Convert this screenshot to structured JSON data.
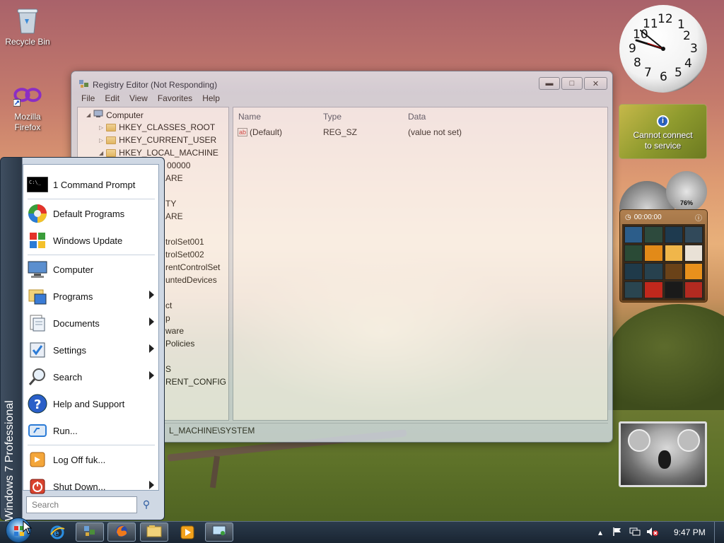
{
  "desktop": {
    "icons": [
      {
        "label": "Recycle Bin",
        "icon": "recycle-bin-icon"
      },
      {
        "label": "Mozilla Firefox",
        "icon": "firefox-shortcut-icon"
      }
    ]
  },
  "registry_window": {
    "title": "Registry Editor (Not Responding)",
    "menu": [
      "File",
      "Edit",
      "View",
      "Favorites",
      "Help"
    ],
    "tree": [
      {
        "label": "Computer"
      },
      {
        "label": "HKEY_CLASSES_ROOT"
      },
      {
        "label": "HKEY_CURRENT_USER"
      },
      {
        "label": "HKEY_LOCAL_MACHINE"
      },
      {
        "label": "00000"
      },
      {
        "label": "ARE"
      },
      {
        "label": "TY"
      },
      {
        "label": "ARE"
      },
      {
        "label": "trolSet001"
      },
      {
        "label": "trolSet002"
      },
      {
        "label": "rentControlSet"
      },
      {
        "label": "untedDevices"
      },
      {
        "label": "ct"
      },
      {
        "label": "p"
      },
      {
        "label": "ware"
      },
      {
        "label": "Policies"
      },
      {
        "label": "S"
      },
      {
        "label": "RENT_CONFIG"
      }
    ],
    "columns": {
      "name": "Name",
      "type": "Type",
      "data": "Data"
    },
    "value_row": {
      "name": "(Default)",
      "type": "REG_SZ",
      "data": "(value not set)"
    },
    "status_path": "L_MACHINE\\SYSTEM"
  },
  "gadgets": {
    "clock": {
      "numbers": [
        "12",
        "1",
        "2",
        "3",
        "4",
        "5",
        "6",
        "7",
        "8",
        "9",
        "10",
        "11"
      ]
    },
    "weather": {
      "message": "Cannot connect to service",
      "info_glyph": "i"
    },
    "meter": {
      "percent": "76%"
    },
    "puzzle": {
      "timer": "00:00:00"
    }
  },
  "start_menu": {
    "brand": "Windows 7 Professional",
    "items": [
      {
        "label": "1 Command Prompt",
        "icon": "command-prompt-icon",
        "submenu": false
      },
      {
        "label": "Default Programs",
        "icon": "default-programs-icon",
        "submenu": false
      },
      {
        "label": "Windows Update",
        "icon": "windows-update-icon",
        "submenu": false
      },
      {
        "label": "Computer",
        "icon": "computer-icon",
        "submenu": false
      },
      {
        "label": "Programs",
        "icon": "programs-icon",
        "submenu": true
      },
      {
        "label": "Documents",
        "icon": "documents-icon",
        "submenu": true
      },
      {
        "label": "Settings",
        "icon": "settings-icon",
        "submenu": true
      },
      {
        "label": "Search",
        "icon": "search-icon",
        "submenu": true
      },
      {
        "label": "Help and Support",
        "icon": "help-icon",
        "submenu": false
      },
      {
        "label": "Run...",
        "icon": "run-icon",
        "submenu": false
      },
      {
        "label": "Log Off fuk...",
        "icon": "log-off-icon",
        "submenu": false
      },
      {
        "label": "Shut Down...",
        "icon": "shut-down-icon",
        "submenu": true
      }
    ],
    "search_placeholder": "Search"
  },
  "taskbar": {
    "pinned": [
      "internet-explorer-icon",
      "registry-editor-icon",
      "firefox-icon",
      "windows-explorer-icon",
      "media-player-icon",
      "remote-desktop-icon"
    ],
    "clock": "9:47 PM"
  }
}
